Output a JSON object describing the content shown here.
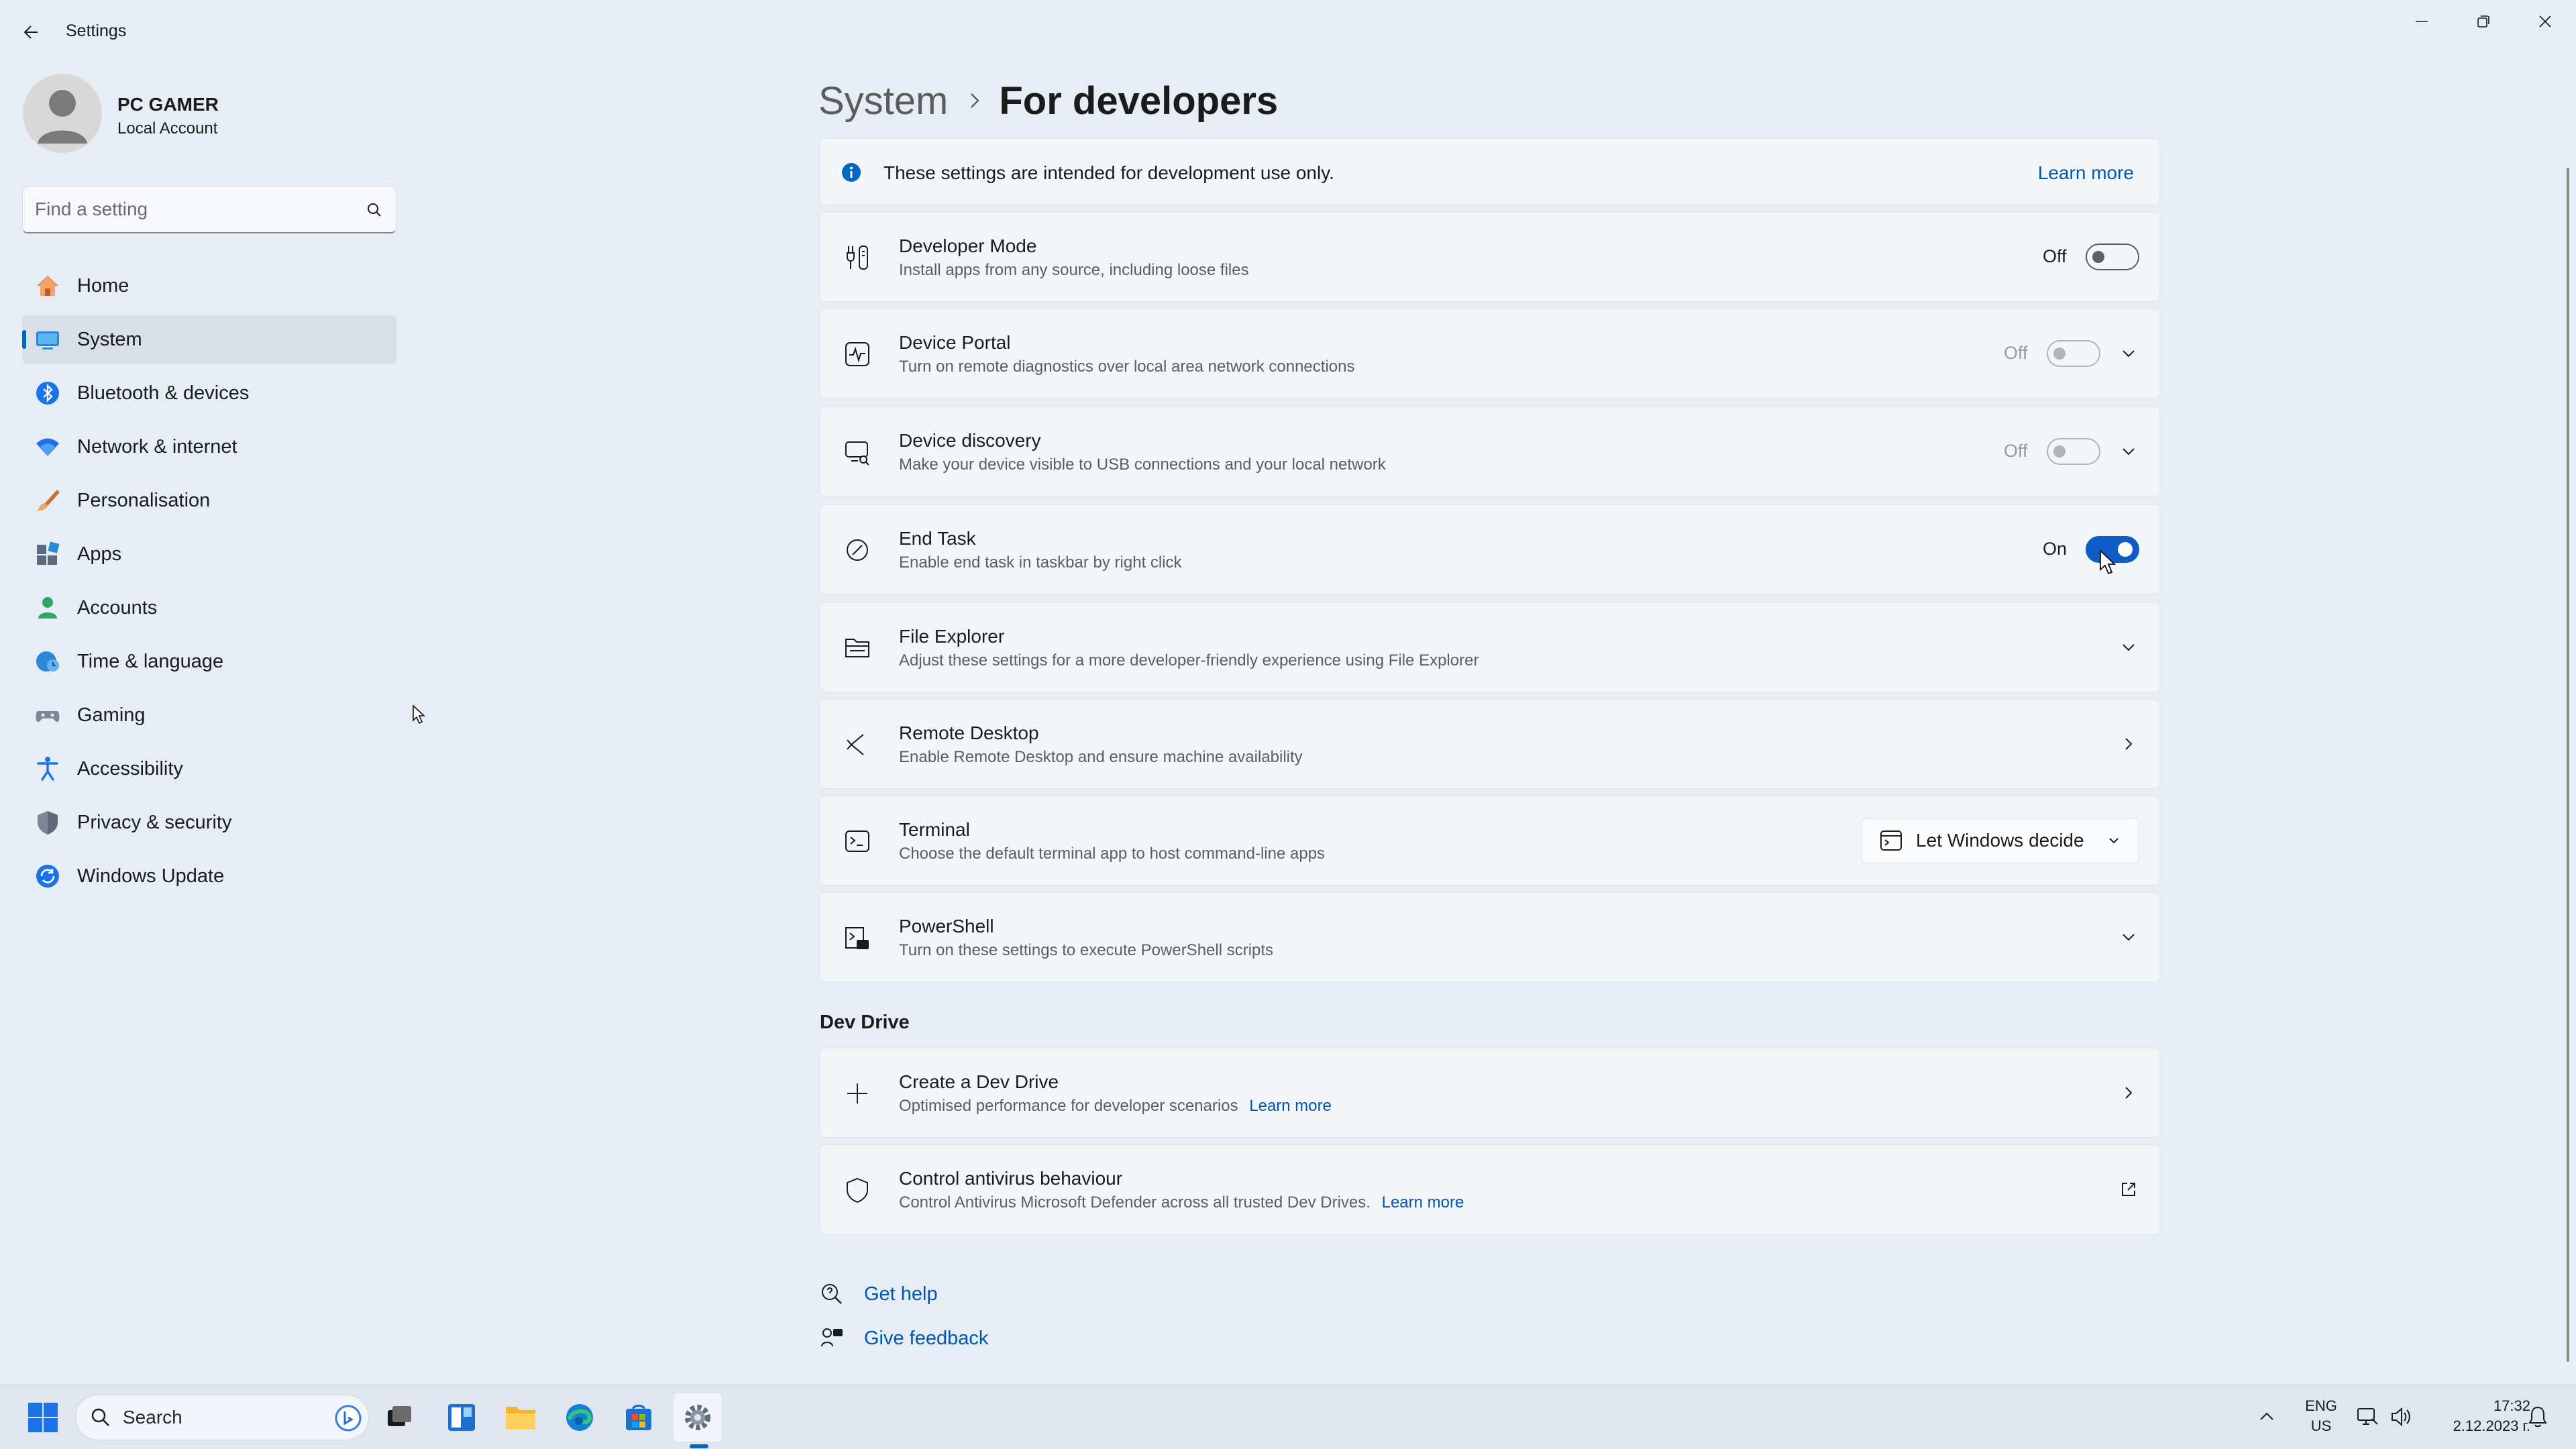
{
  "window": {
    "title": "Settings"
  },
  "user": {
    "name": "PC GAMER",
    "account_type": "Local Account"
  },
  "search": {
    "placeholder": "Find a setting"
  },
  "nav": {
    "items": [
      {
        "label": "Home",
        "icon": "home-icon",
        "selected": false
      },
      {
        "label": "System",
        "icon": "system-icon",
        "selected": true
      },
      {
        "label": "Bluetooth & devices",
        "icon": "bluetooth-icon",
        "selected": false
      },
      {
        "label": "Network & internet",
        "icon": "wifi-icon",
        "selected": false
      },
      {
        "label": "Personalisation",
        "icon": "brush-icon",
        "selected": false
      },
      {
        "label": "Apps",
        "icon": "apps-icon",
        "selected": false
      },
      {
        "label": "Accounts",
        "icon": "accounts-icon",
        "selected": false
      },
      {
        "label": "Time & language",
        "icon": "globe-clock-icon",
        "selected": false
      },
      {
        "label": "Gaming",
        "icon": "gamepad-icon",
        "selected": false
      },
      {
        "label": "Accessibility",
        "icon": "accessibility-icon",
        "selected": false
      },
      {
        "label": "Privacy & security",
        "icon": "shield-icon",
        "selected": false
      },
      {
        "label": "Windows Update",
        "icon": "update-icon",
        "selected": false
      }
    ]
  },
  "header": {
    "parent": "System",
    "current": "For developers"
  },
  "info_banner": {
    "text": "These settings are intended for development use only.",
    "link": "Learn more"
  },
  "settings": [
    {
      "title": "Developer Mode",
      "description": "Install apps from any source, including loose files",
      "state": "Off",
      "toggle_on": false,
      "enabled": true
    },
    {
      "title": "Device Portal",
      "description": "Turn on remote diagnostics over local area network connections",
      "state": "Off",
      "toggle_on": false,
      "enabled": false
    },
    {
      "title": "Device discovery",
      "description": "Make your device visible to USB connections and your local network",
      "state": "Off",
      "toggle_on": false,
      "enabled": false
    },
    {
      "title": "End Task",
      "description": "Enable end task in taskbar by right click",
      "state": "On",
      "toggle_on": true,
      "enabled": true
    },
    {
      "title": "File Explorer",
      "description": "Adjust these settings for a more developer-friendly experience using File Explorer"
    },
    {
      "title": "Remote Desktop",
      "description": "Enable Remote Desktop and ensure machine availability"
    },
    {
      "title": "Terminal",
      "description": "Choose the default terminal app to host command-line apps",
      "dropdown_value": "Let Windows decide"
    },
    {
      "title": "PowerShell",
      "description": "Turn on these settings to execute PowerShell scripts"
    }
  ],
  "dev_drive": {
    "section_title": "Dev Drive",
    "items": [
      {
        "title": "Create a Dev Drive",
        "description": "Optimised performance for developer scenarios",
        "link": "Learn more"
      },
      {
        "title": "Control antivirus behaviour",
        "description": "Control Antivirus Microsoft Defender across all trusted Dev Drives.",
        "link": "Learn more"
      }
    ]
  },
  "help": {
    "get_help": "Get help",
    "give_feedback": "Give feedback"
  },
  "taskbar": {
    "search_label": "Search",
    "language": "ENG",
    "region": "US",
    "time": "17:32",
    "date": "2.12.2023 г."
  },
  "colors": {
    "accent": "#0067c0",
    "toggle_on": "#0f5cc6",
    "link": "#0056b3"
  }
}
